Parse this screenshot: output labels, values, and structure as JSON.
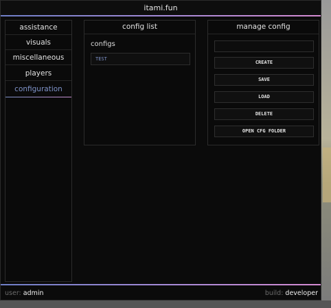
{
  "window": {
    "title": "itami.fun"
  },
  "sidebar": {
    "items": [
      {
        "label": "assistance",
        "active": false
      },
      {
        "label": "visuals",
        "active": false
      },
      {
        "label": "miscellaneous",
        "active": false
      },
      {
        "label": "players",
        "active": false
      },
      {
        "label": "configuration",
        "active": true
      }
    ]
  },
  "config_list": {
    "header": "config list",
    "section_label": "configs",
    "items": [
      "TEST"
    ]
  },
  "manage_config": {
    "header": "manage config",
    "name_input": {
      "value": "",
      "placeholder": ""
    },
    "buttons": {
      "create": "CREATE",
      "save": "SAVE",
      "load": "LOAD",
      "delete": "DELETE",
      "open_folder": "OPEN CFG FOLDER"
    }
  },
  "footer": {
    "user_label": "user:",
    "user_value": "admin",
    "build_label": "build:",
    "build_value": "developer"
  },
  "colors": {
    "accent_blue": "#7f93c9",
    "accent_pink": "#d58bd2",
    "panel_bg": "#0a0a0a"
  }
}
